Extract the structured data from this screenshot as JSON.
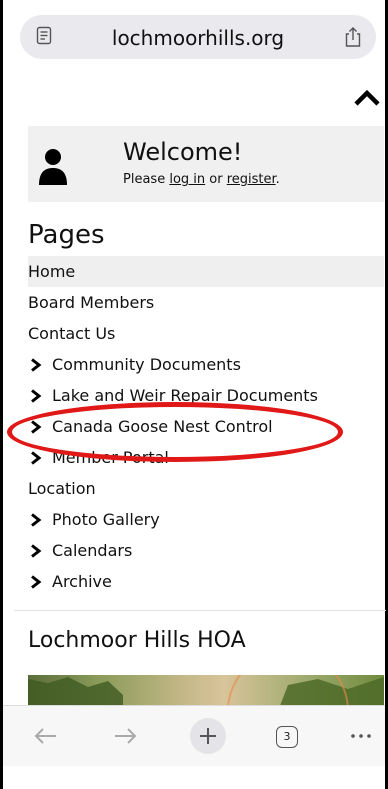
{
  "browser": {
    "host": "lochmoorhills.org",
    "tab_count": "3",
    "icons": [
      "reader-mode-icon",
      "share-icon",
      "back-icon",
      "forward-icon",
      "plus-icon",
      "tabs-icon",
      "more-icon"
    ]
  },
  "welcome": {
    "title": "Welcome!",
    "please": "Please ",
    "login": "log in",
    "or": " or ",
    "register": "register",
    "period": "."
  },
  "pages": {
    "heading": "Pages",
    "items": [
      {
        "label": "Home",
        "chevron": false,
        "active": true
      },
      {
        "label": "Board Members",
        "chevron": false
      },
      {
        "label": "Contact Us",
        "chevron": false
      },
      {
        "label": "Community Documents",
        "chevron": true
      },
      {
        "label": "Lake and Weir Repair Documents",
        "chevron": true
      },
      {
        "label": "Canada Goose Nest Control",
        "chevron": true
      },
      {
        "label": "Member Portal",
        "chevron": true
      },
      {
        "label": "Location",
        "chevron": false
      },
      {
        "label": "Photo Gallery",
        "chevron": true
      },
      {
        "label": "Calendars",
        "chevron": true
      },
      {
        "label": "Archive",
        "chevron": true
      }
    ]
  },
  "section": {
    "title": "Lochmoor Hills HOA"
  },
  "colors": {
    "highlight": "#e01818",
    "panel": "#f0f0f0",
    "urlbar": "#e9e9ee"
  }
}
